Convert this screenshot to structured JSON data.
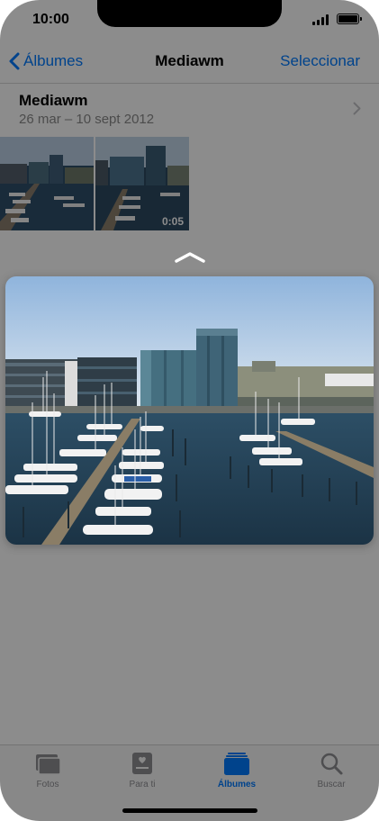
{
  "status_bar": {
    "time": "10:00"
  },
  "nav": {
    "back_label": "Álbumes",
    "title": "Mediawm",
    "select_label": "Seleccionar"
  },
  "album": {
    "title": "Mediawm",
    "dates": "26 mar – 10 sept 2012"
  },
  "thumbnails": [
    {
      "kind": "photo"
    },
    {
      "kind": "video",
      "duration": "0:05"
    }
  ],
  "preview": {
    "subject": "marina-with-sailboats-and-office-buildings"
  },
  "tabbar": {
    "tabs": [
      {
        "label": "Fotos",
        "icon": "photos-icon",
        "active": false
      },
      {
        "label": "Para ti",
        "icon": "for-you-icon",
        "active": false
      },
      {
        "label": "Álbumes",
        "icon": "albums-icon",
        "active": true
      },
      {
        "label": "Buscar",
        "icon": "search-icon",
        "active": false
      }
    ]
  },
  "colors": {
    "accent": "#007aff",
    "inactive": "#8e8e93",
    "overlay": "rgba(0,0,0,0.45)"
  }
}
